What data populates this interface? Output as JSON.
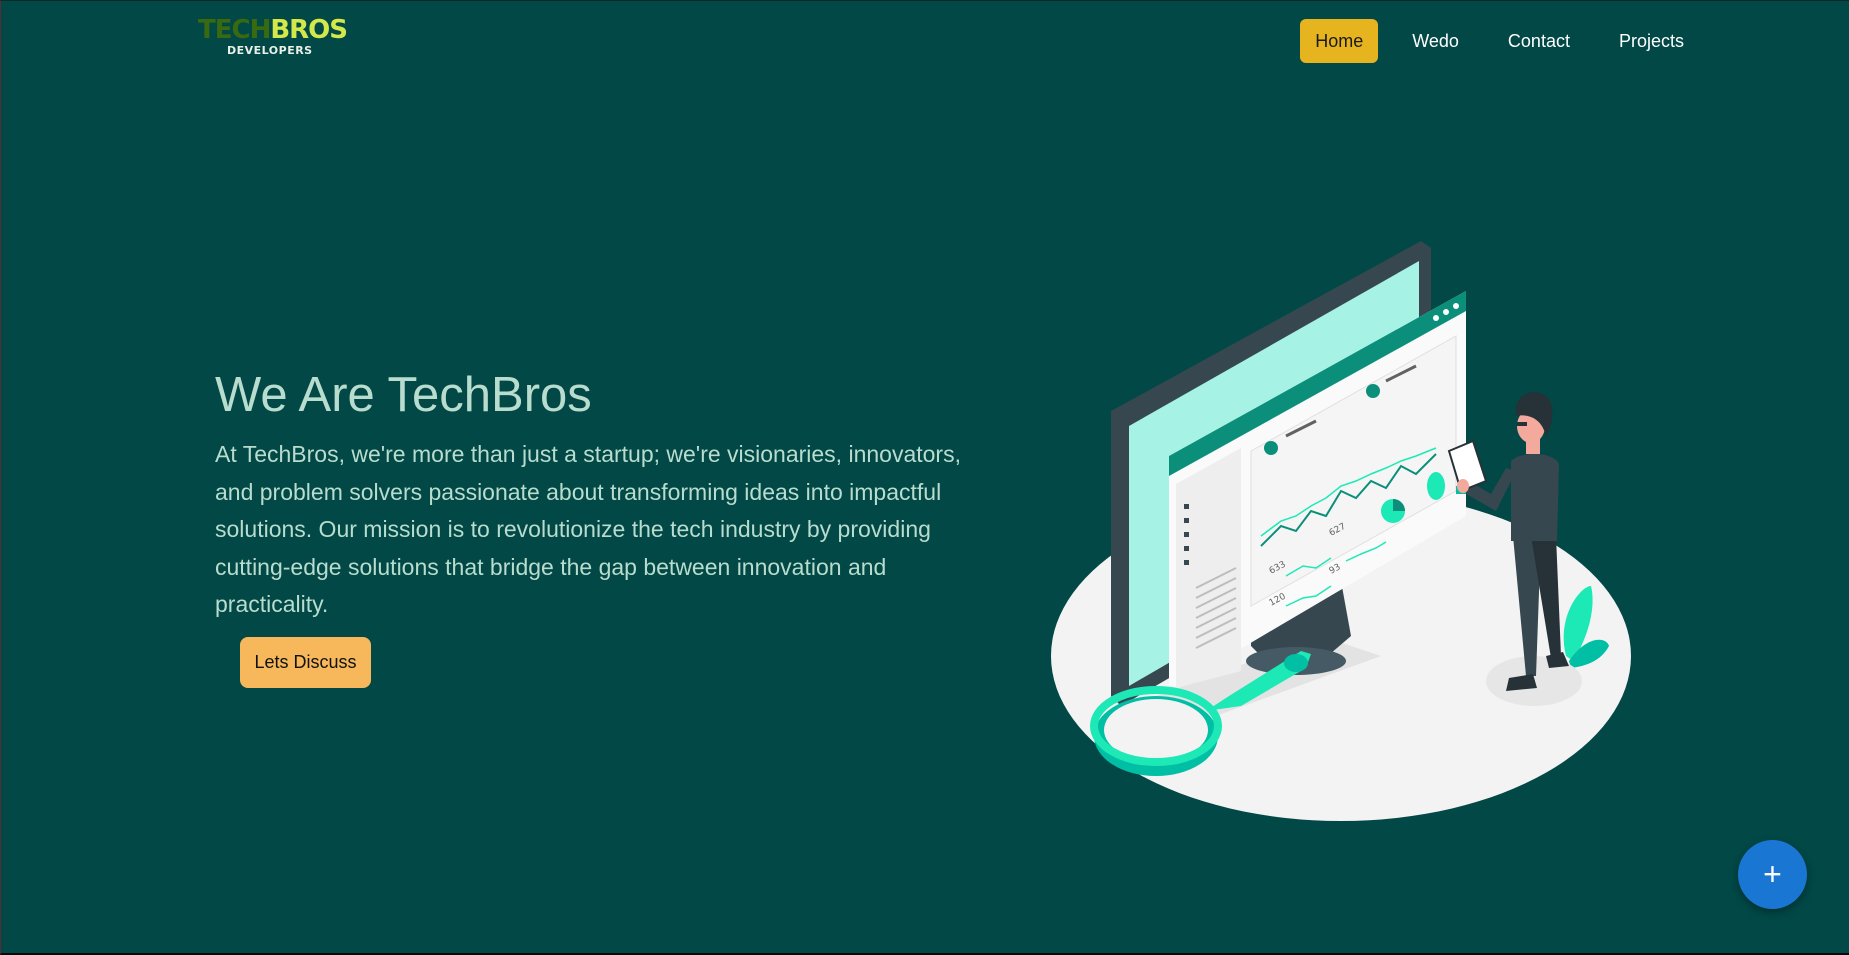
{
  "logo": {
    "tech": "TECH",
    "bros": "BROS",
    "subtitle": "DEVELOPERS"
  },
  "nav": {
    "items": [
      {
        "label": "Home",
        "active": true
      },
      {
        "label": "Wedo",
        "active": false
      },
      {
        "label": "Contact",
        "active": false
      },
      {
        "label": "Projects",
        "active": false
      }
    ]
  },
  "hero": {
    "title": "We Are TechBros",
    "description": "At TechBros, we're more than just a startup; we're visionaries, innovators, and problem solvers passionate about transforming ideas into impactful solutions. Our mission is to revolutionize the tech industry by providing cutting-edge solutions that bridge the gap between innovation and practicality.",
    "cta_label": "Lets Discuss"
  },
  "illustration": {
    "chart_labels": [
      "633",
      "627",
      "93",
      "120"
    ]
  },
  "fab": {
    "icon": "plus-icon",
    "symbol": "+"
  },
  "colors": {
    "background": "#014846",
    "nav_active": "#e6b41e",
    "cta": "#f6b85a",
    "fab": "#1976d2",
    "hero_text": "#b8dccd"
  }
}
